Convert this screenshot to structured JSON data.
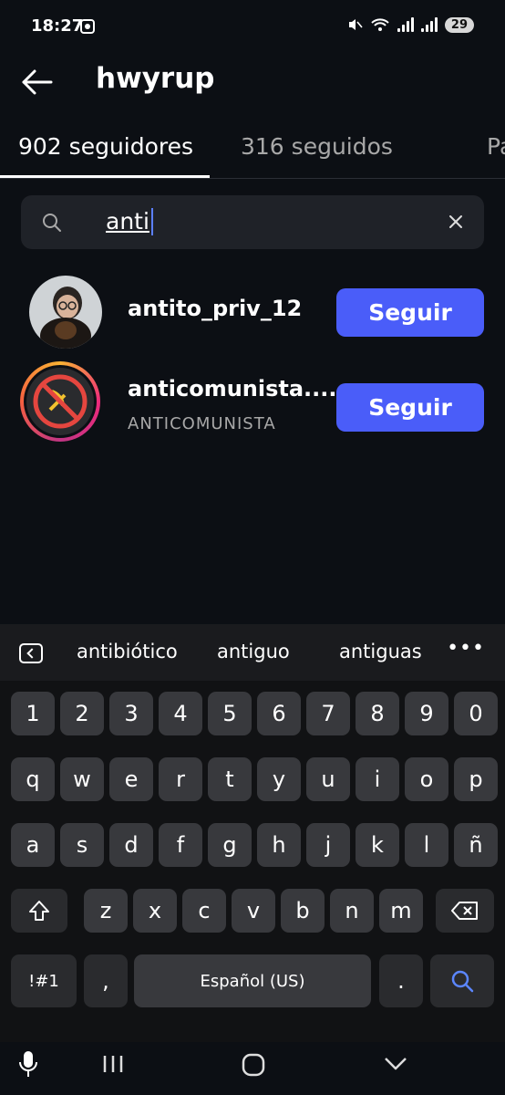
{
  "status_bar": {
    "time": "18:27",
    "battery": "29"
  },
  "header": {
    "title": "hwyrup"
  },
  "tabs": [
    {
      "label": "902 seguidores"
    },
    {
      "label": "316 seguidos"
    },
    {
      "label": "Pa"
    }
  ],
  "search": {
    "value": "anti"
  },
  "results": [
    {
      "username": "antito_priv_12",
      "full_name": "",
      "button": "Seguir"
    },
    {
      "username": "anticomunista....",
      "full_name": "ANTICOMUNISTA",
      "button": "Seguir"
    }
  ],
  "keyboard": {
    "suggestions": [
      "antibiótico",
      "antiguo",
      "antiguas"
    ],
    "row_numbers": [
      "1",
      "2",
      "3",
      "4",
      "5",
      "6",
      "7",
      "8",
      "9",
      "0"
    ],
    "row1": [
      "q",
      "w",
      "e",
      "r",
      "t",
      "y",
      "u",
      "i",
      "o",
      "p"
    ],
    "row2": [
      "a",
      "s",
      "d",
      "f",
      "g",
      "h",
      "j",
      "k",
      "l",
      "ñ"
    ],
    "row3": [
      "z",
      "x",
      "c",
      "v",
      "b",
      "n",
      "m"
    ],
    "symbols_key": "!#1",
    "comma": ",",
    "space_label": "Español (US)",
    "period": "."
  },
  "colors": {
    "accent": "#4a5df9",
    "background": "#0c0f14"
  }
}
